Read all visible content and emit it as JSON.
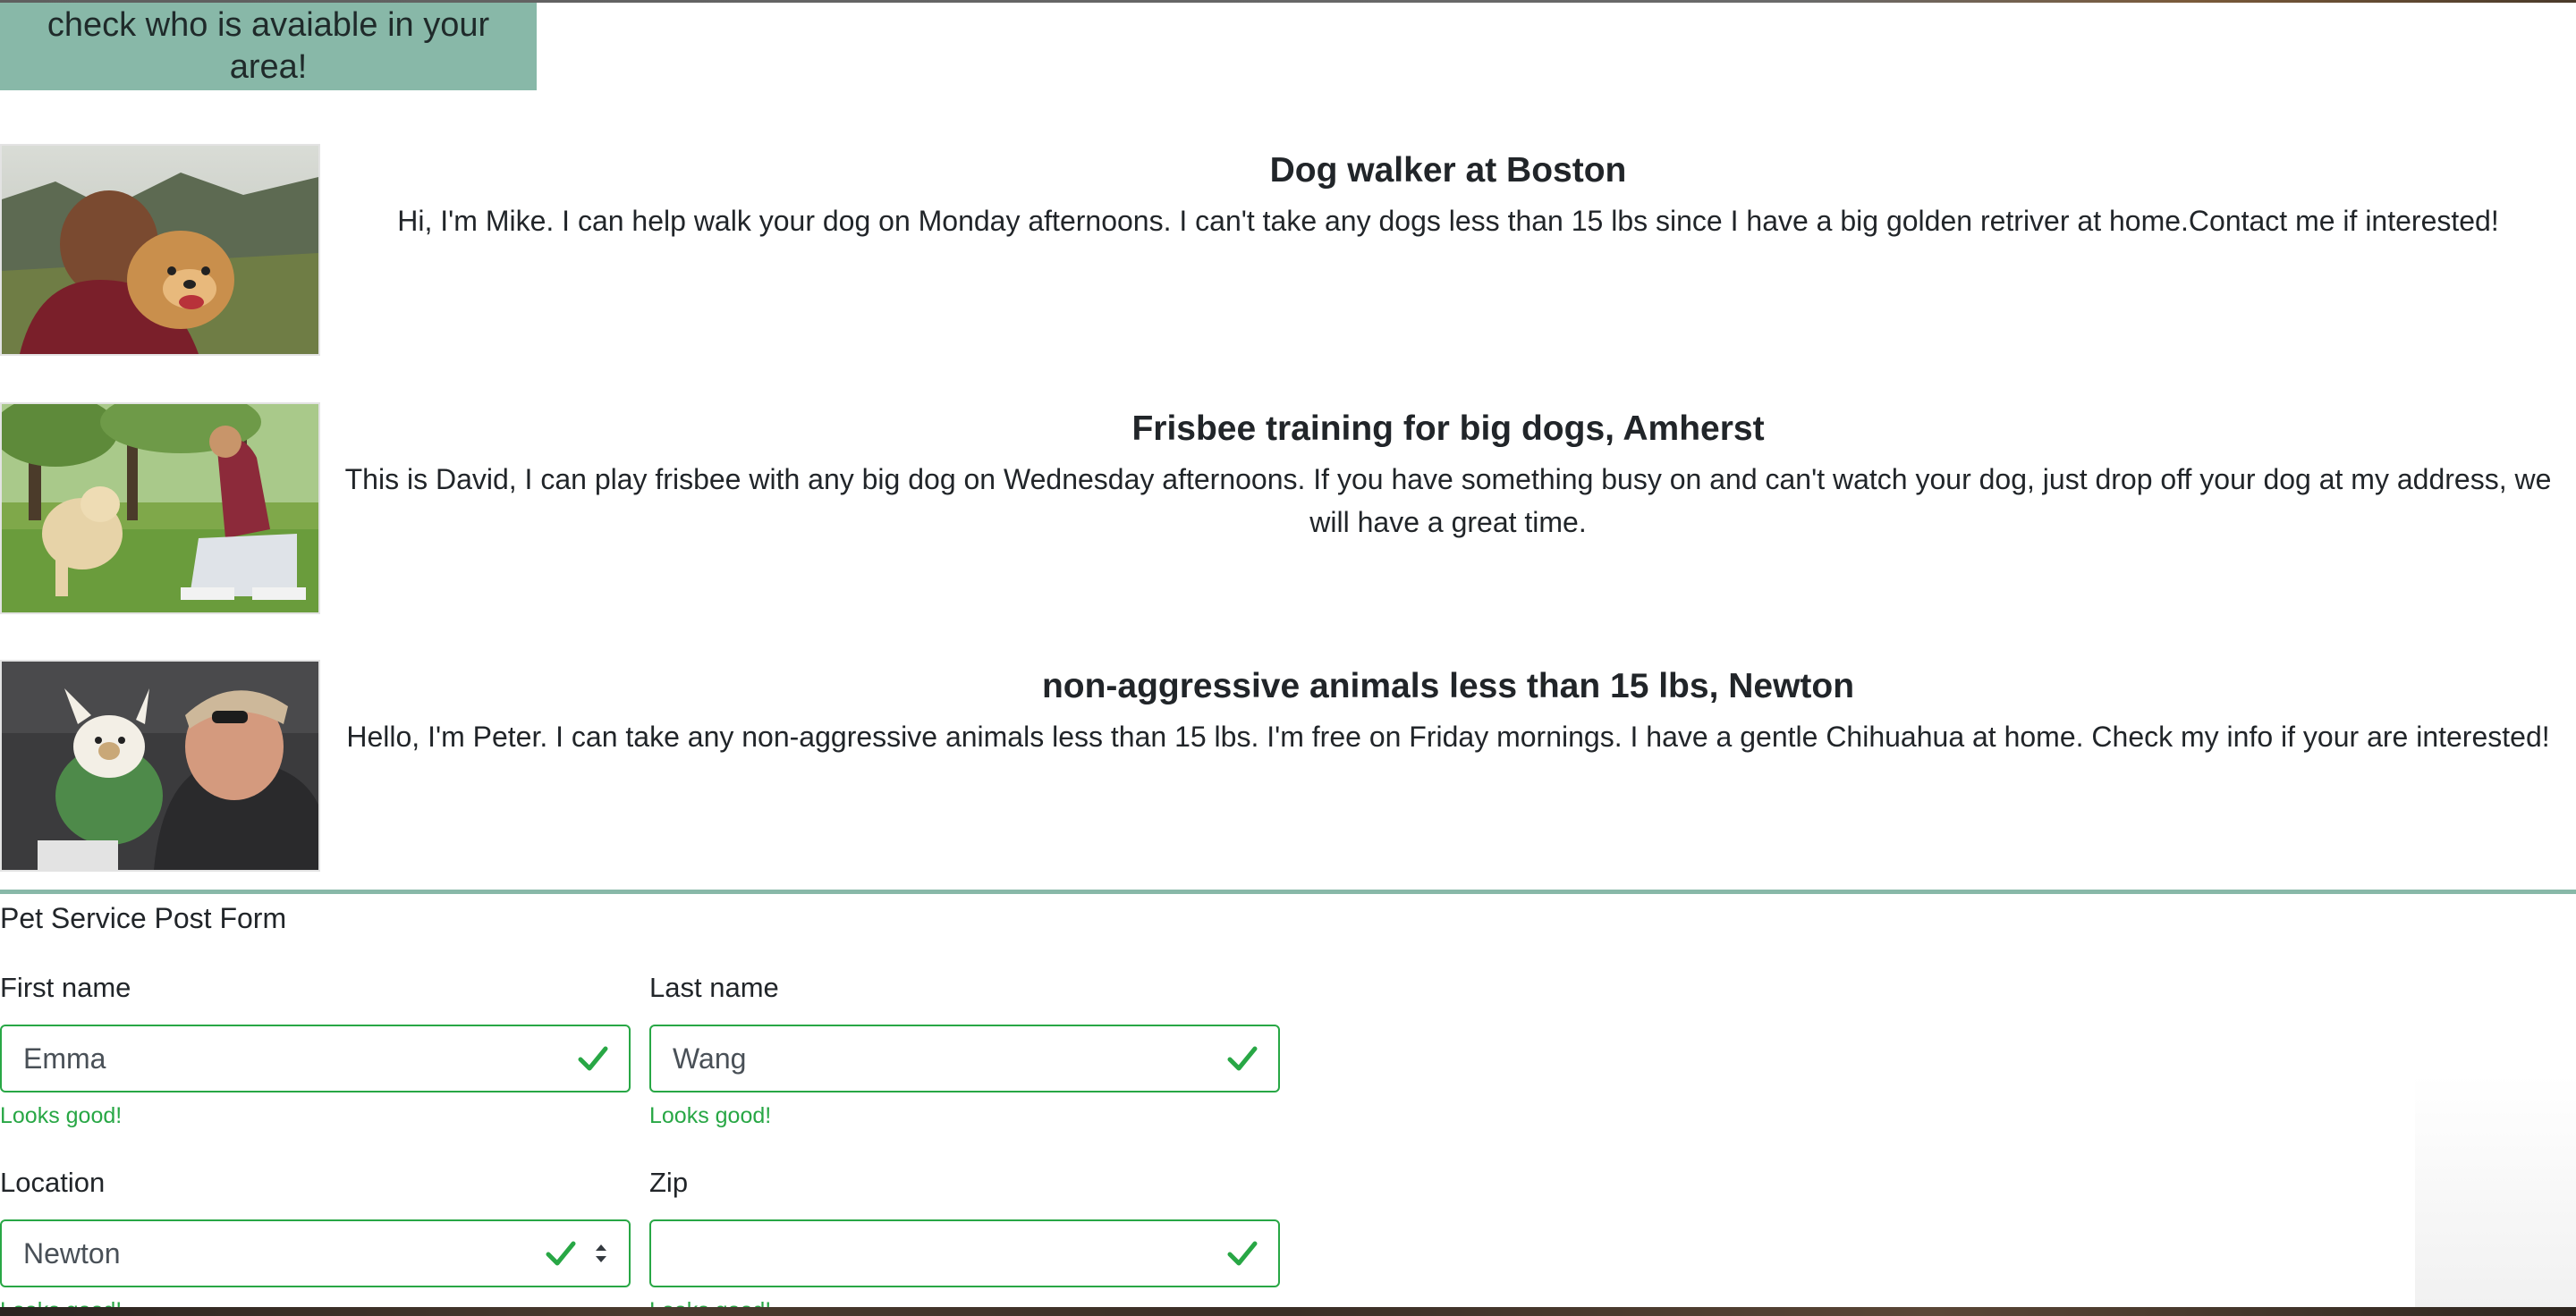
{
  "banner": {
    "text": "check who is avaiable in your area!"
  },
  "services": [
    {
      "title": "Dog walker at Boston",
      "description": "Hi, I'm Mike. I can help walk your dog on Monday afternoons. I can't take any dogs less than 15 lbs since I have a big golden retriver at home.Contact me if interested!"
    },
    {
      "title": "Frisbee training for big dogs, Amherst",
      "description": "This is David, I can play frisbee with any big dog on Wednesday afternoons. If you have something busy on and can't watch your dog, just drop off your dog at my address, we will have a great time."
    },
    {
      "title": "non-aggressive animals less than 15 lbs, Newton",
      "description": "Hello, I'm Peter. I can take any non-aggressive animals less than 15 lbs. I'm free on Friday mornings. I have a gentle Chihuahua at home. Check my info if your are interested!"
    }
  ],
  "form": {
    "title": "Pet Service Post Form",
    "first_name": {
      "label": "First name",
      "value": "Emma",
      "feedback": "Looks good!"
    },
    "last_name": {
      "label": "Last name",
      "value": "Wang",
      "feedback": "Looks good!"
    },
    "location": {
      "label": "Location",
      "value": "Newton",
      "feedback": "Looks good!"
    },
    "zip": {
      "label": "Zip",
      "value": "",
      "feedback": "Looks good!"
    }
  },
  "colors": {
    "accent": "#88b8a8",
    "valid": "#28a745"
  }
}
